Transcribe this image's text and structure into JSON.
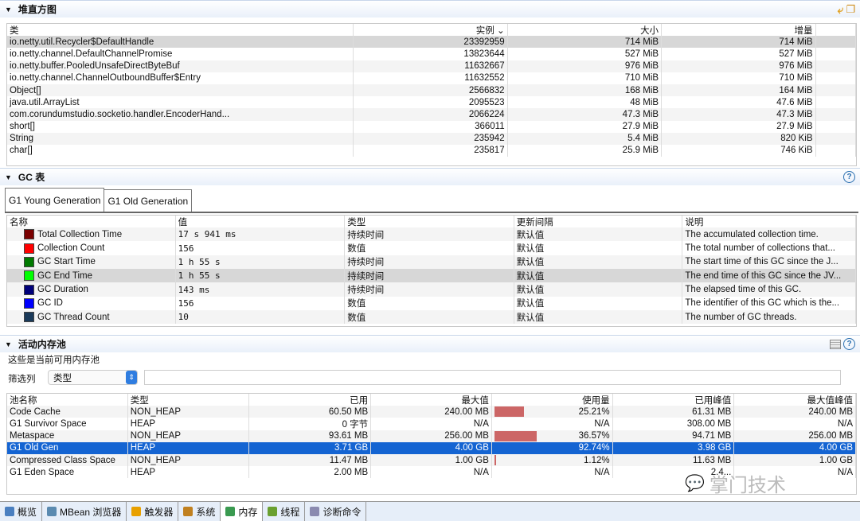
{
  "heap": {
    "title": "堆直方图",
    "columns": [
      "类",
      "实例 ⌄",
      "大小",
      "增量"
    ],
    "rows": [
      [
        "io.netty.util.Recycler$DefaultHandle",
        "23392959",
        "714 MiB",
        "714 MiB"
      ],
      [
        "io.netty.channel.DefaultChannelPromise",
        "13823644",
        "527 MiB",
        "527 MiB"
      ],
      [
        "io.netty.buffer.PooledUnsafeDirectByteBuf",
        "11632667",
        "976 MiB",
        "976 MiB"
      ],
      [
        "io.netty.channel.ChannelOutboundBuffer$Entry",
        "11632552",
        "710 MiB",
        "710 MiB"
      ],
      [
        "Object[]",
        "2566832",
        "168 MiB",
        "164 MiB"
      ],
      [
        "java.util.ArrayList",
        "2095523",
        "48 MiB",
        "47.6 MiB"
      ],
      [
        "com.corundumstudio.socketio.handler.EncoderHand...",
        "2066224",
        "47.3 MiB",
        "47.3 MiB"
      ],
      [
        "short[]",
        "366011",
        "27.9 MiB",
        "27.9 MiB"
      ],
      [
        "String",
        "235942",
        "5.4 MiB",
        "820 KiB"
      ],
      [
        "char[]",
        "235817",
        "25.9 MiB",
        "746 KiB"
      ]
    ]
  },
  "gc": {
    "title": "GC 表",
    "tabs": [
      "G1 Young Generation",
      "G1 Old Generation"
    ],
    "columns": [
      "名称",
      "值",
      "类型",
      "更新间隔",
      "说明"
    ],
    "rows": [
      {
        "color": "#7a0000",
        "name": "Total Collection Time",
        "value": "17 s 941 ms",
        "type": "持续时间",
        "interval": "默认值",
        "desc": "The accumulated collection time."
      },
      {
        "color": "#ff0000",
        "name": "Collection Count",
        "value": "156",
        "type": "数值",
        "interval": "默认值",
        "desc": "The total number of collections that..."
      },
      {
        "color": "#007a00",
        "name": "GC Start Time",
        "value": "1 h 55 s",
        "type": "持续时间",
        "interval": "默认值",
        "desc": "The start time of this GC since the J..."
      },
      {
        "color": "#00ff00",
        "name": "GC End Time",
        "value": "1 h 55 s",
        "type": "持续时间",
        "interval": "默认值",
        "desc": "The end time of this GC since the JV..."
      },
      {
        "color": "#00007a",
        "name": "GC Duration",
        "value": "143 ms",
        "type": "持续时间",
        "interval": "默认值",
        "desc": "The elapsed time of this GC."
      },
      {
        "color": "#0000ff",
        "name": "GC ID",
        "value": "156",
        "type": "数值",
        "interval": "默认值",
        "desc": "The identifier of this GC which is the..."
      },
      {
        "color": "#1a3a5a",
        "name": "GC Thread Count",
        "value": "10",
        "type": "数值",
        "interval": "默认值",
        "desc": "The number of GC threads."
      }
    ]
  },
  "pools": {
    "title": "活动内存池",
    "subtitle": "这些是当前可用内存池",
    "filter_label": "筛选列",
    "filter_value": "类型",
    "filter_text": "",
    "columns": [
      "池名称",
      "类型",
      "已用",
      "最大值",
      "使用量",
      "已用峰值",
      "最大值峰值"
    ],
    "rows": [
      {
        "name": "Code Cache",
        "type": "NON_HEAP",
        "used": "60.50 MB",
        "max": "240.00 MB",
        "usage": "25.21%",
        "usage_pct": 25.21,
        "peak": "61.31 MB",
        "maxpeak": "240.00 MB"
      },
      {
        "name": "G1 Survivor Space",
        "type": "HEAP",
        "used": "0 字节",
        "max": "N/A",
        "usage": "N/A",
        "usage_pct": 0,
        "peak": "308.00 MB",
        "maxpeak": "N/A"
      },
      {
        "name": "Metaspace",
        "type": "NON_HEAP",
        "used": "93.61 MB",
        "max": "256.00 MB",
        "usage": "36.57%",
        "usage_pct": 36.57,
        "peak": "94.71 MB",
        "maxpeak": "256.00 MB"
      },
      {
        "name": "G1 Old Gen",
        "type": "HEAP",
        "used": "3.71 GB",
        "max": "4.00 GB",
        "usage": "92.74%",
        "usage_pct": 92.74,
        "peak": "3.98 GB",
        "maxpeak": "4.00 GB"
      },
      {
        "name": "Compressed Class Space",
        "type": "NON_HEAP",
        "used": "11.47 MB",
        "max": "1.00 GB",
        "usage": "1.12%",
        "usage_pct": 1.12,
        "peak": "11.63 MB",
        "maxpeak": "1.00 GB"
      },
      {
        "name": "G1 Eden Space",
        "type": "HEAP",
        "used": "2.00 MB",
        "max": "N/A",
        "usage": "N/A",
        "usage_pct": 0,
        "peak": "2.4...",
        "maxpeak": "N/A"
      }
    ],
    "bar_color": "#cc6666"
  },
  "bottom_tabs": [
    {
      "label": "概览",
      "icon": "overview-icon"
    },
    {
      "label": "MBean 浏览器",
      "icon": "mbean-icon"
    },
    {
      "label": "触发器",
      "icon": "trigger-icon"
    },
    {
      "label": "系统",
      "icon": "system-icon"
    },
    {
      "label": "内存",
      "icon": "memory-icon",
      "active": true
    },
    {
      "label": "线程",
      "icon": "thread-icon"
    },
    {
      "label": "诊断命令",
      "icon": "diagnostic-icon"
    }
  ],
  "watermark": "掌门技术",
  "selection_color": "#1464d2"
}
